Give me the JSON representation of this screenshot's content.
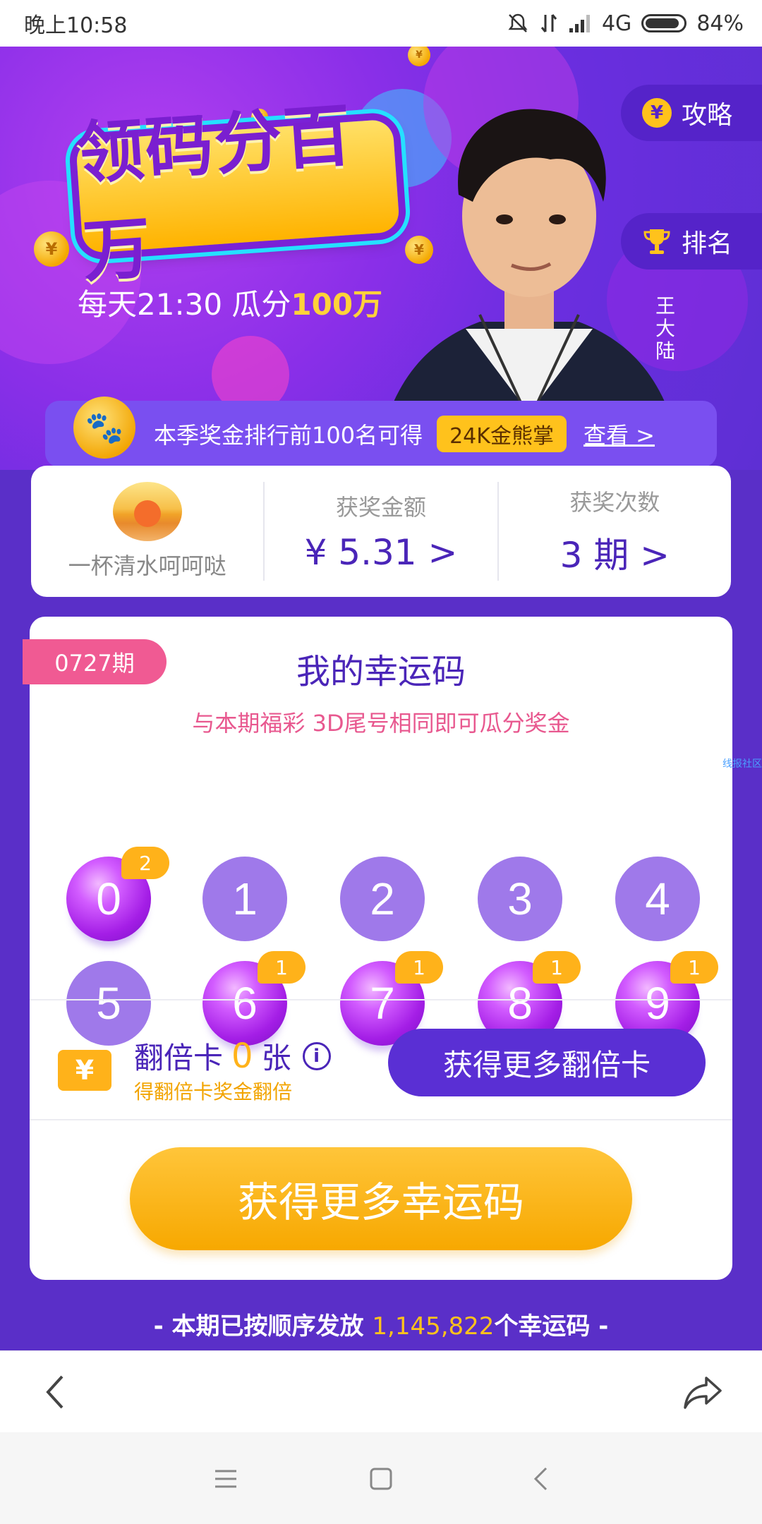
{
  "status": {
    "time": "晚上10:58",
    "network": "4G",
    "battery": "84%"
  },
  "hero": {
    "logo_text": "领码分百万",
    "subtitle_prefix": "每天21:30 瓜分",
    "subtitle_amount": "100万",
    "star_name": "王大陆",
    "strategy_label": "攻略",
    "rank_label": "排名"
  },
  "promo": {
    "text": "本季奖金排行前100名可得",
    "tag": "24K金熊掌",
    "link": "查看 >"
  },
  "stats": {
    "username": "一杯清水呵呵哒",
    "amount_label": "获奖金额",
    "amount_value": "¥ 5.31 >",
    "count_label": "获奖次数",
    "count_value": "3 期 >"
  },
  "lucky": {
    "period": "0727期",
    "title": "我的幸运码",
    "subtitle": "与本期福彩 3D尾号相同即可瓜分奖金",
    "digits": [
      {
        "digit": "0",
        "count": "2"
      },
      {
        "digit": "1",
        "count": ""
      },
      {
        "digit": "2",
        "count": ""
      },
      {
        "digit": "3",
        "count": ""
      },
      {
        "digit": "4",
        "count": ""
      },
      {
        "digit": "5",
        "count": ""
      },
      {
        "digit": "6",
        "count": "1"
      },
      {
        "digit": "7",
        "count": "1"
      },
      {
        "digit": "8",
        "count": "1"
      },
      {
        "digit": "9",
        "count": "1"
      }
    ],
    "double_card_label": "翻倍卡",
    "double_card_count": "0",
    "double_card_unit": "张",
    "double_card_desc": "得翻倍卡奖金翻倍",
    "more_cards_button": "获得更多翻倍卡",
    "more_codes_button": "获得更多幸运码"
  },
  "issued": {
    "prefix": "- 本期已按顺序发放 ",
    "count": "1,145,822",
    "suffix": "个幸运码 -"
  },
  "watermark": "线报社区",
  "colors": {
    "brand_purple": "#5a2fd4",
    "accent_gold": "#ffb21a",
    "pink": "#f05a93"
  }
}
